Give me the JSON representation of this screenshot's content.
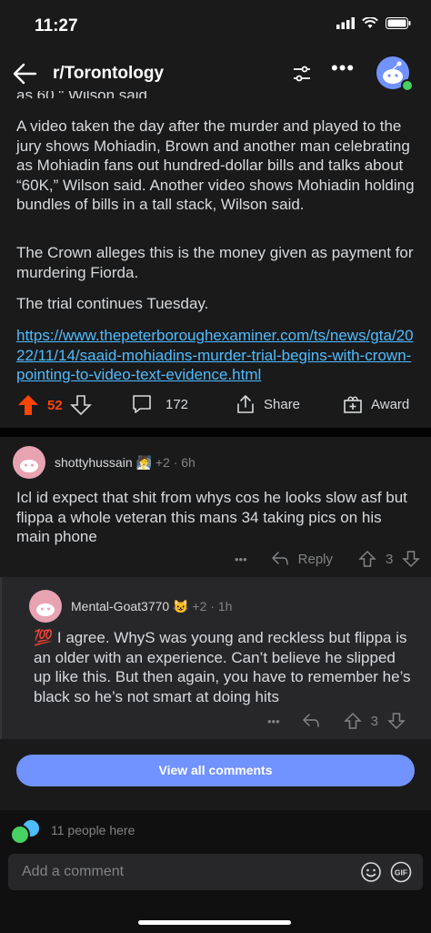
{
  "status_bar": {
    "time": "11:27"
  },
  "header": {
    "title": "r/Torontology",
    "more": "•••"
  },
  "post": {
    "cutoff_line": "as 60,\" Wilson said.",
    "paragraphs": [
      "A video taken the day after the murder and played to the jury shows Mohiadin, Brown and another man celebrating as Mohiadin fans out hundred-dollar bills and talks about “60K,” Wilson said. Another video shows Mohiadin holding bundles of bills in a tall stack, Wilson said.",
      "The Crown alleges this is the money given as payment for murdering Fiorda.",
      "The trial continues Tuesday."
    ],
    "link": "https://www.thepeterboroughexaminer.com/ts/news/gta/2022/11/14/saaid-mohiadins-murder-trial-begins-with-crown-pointing-to-video-text-evidence.html",
    "score": "52",
    "comments": "172",
    "share_label": "Share",
    "award_label": "Award"
  },
  "comments": [
    {
      "username": "shottyhussain",
      "karma_delta": "+2",
      "age": "6h",
      "text": "Icl id expect that shit from whys cos he looks slow asf but flippa a whole veteran this mans 34 taking pics on his main phone",
      "more": "•••",
      "reply_label": "Reply",
      "score": "3"
    },
    {
      "username": "Mental-Goat3770",
      "karma_delta": "+2",
      "age": "1h",
      "emoji": "💯",
      "text": " I agree. WhyS was young and reckless but flippa is an older with an experience. Can’t believe he slipped up like this. But then again, you have to remember he’s black so he’s not smart at doing hits",
      "more": "•••",
      "score": "3"
    }
  ],
  "view_all_label": "View all comments",
  "presence": "11 people here",
  "comment_input": {
    "placeholder": "Add a comment"
  },
  "colors": {
    "upvote": "#ff4500",
    "link": "#4fbcff",
    "button": "#7193ff",
    "background": "#1a1a1b"
  }
}
